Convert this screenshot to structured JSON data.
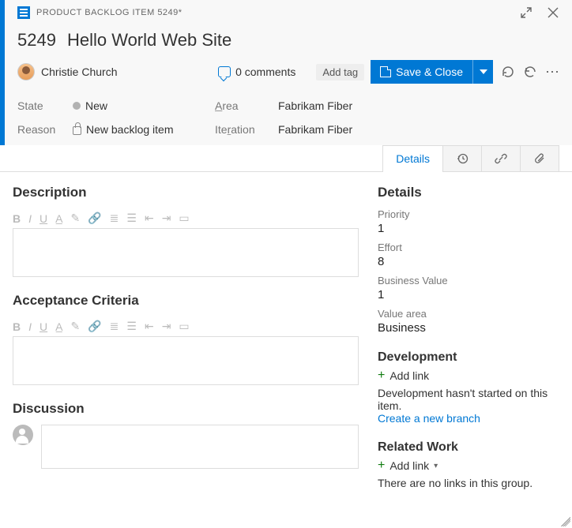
{
  "titlebar": {
    "text": "PRODUCT BACKLOG ITEM 5249*"
  },
  "workitem": {
    "id": "5249",
    "title": "Hello World Web Site"
  },
  "assignee": "Christie Church",
  "comments_label": "0 comments",
  "add_tag_label": "Add tag",
  "save_label": "Save & Close",
  "fields": {
    "state_label": "State",
    "state_value": "New",
    "area_label_pre": "A",
    "area_label_post": "rea",
    "area_value": "Fabrikam Fiber",
    "reason_label": "Reason",
    "reason_value": "New backlog item",
    "iteration_label_pre": "Ite",
    "iteration_label_post": "ration",
    "iteration_value": "Fabrikam Fiber"
  },
  "tabs": {
    "details": "Details"
  },
  "left": {
    "description_title": "Description",
    "acceptance_title": "Acceptance Criteria",
    "discussion_title": "Discussion",
    "toolbar": {
      "bold": "B",
      "italic": "I",
      "underline": "U"
    }
  },
  "right": {
    "details_title": "Details",
    "priority_label": "Priority",
    "priority_value": "1",
    "effort_label": "Effort",
    "effort_value": "8",
    "bv_label": "Business Value",
    "bv_value": "1",
    "va_label": "Value area",
    "va_value": "Business",
    "dev_title": "Development",
    "add_link": "Add link",
    "dev_empty": "Development hasn't started on this item.",
    "dev_link": "Create a new branch",
    "related_title": "Related Work",
    "related_empty": "There are no links in this group."
  }
}
